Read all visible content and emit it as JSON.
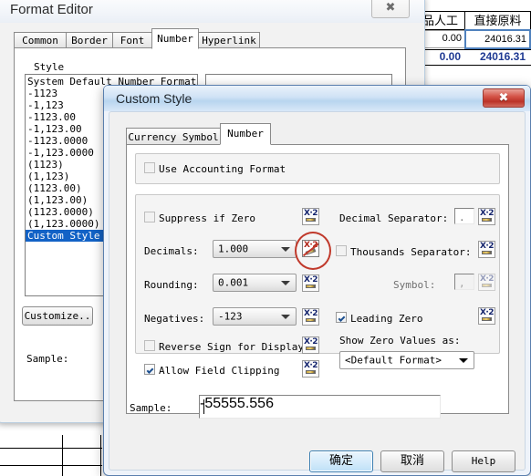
{
  "background_sheet": {
    "headers": [
      {
        "label": "品人工"
      },
      {
        "label": "直接原料"
      }
    ],
    "row_values": [
      "0.00",
      "24016.31"
    ],
    "total_values": [
      "0.00",
      "24016.31"
    ],
    "left_values": [
      "172",
      "70"
    ]
  },
  "format_editor": {
    "title": "Format Editor",
    "close_glyph": "✖",
    "tabs": [
      {
        "label": "Common",
        "selected": false
      },
      {
        "label": "Border",
        "selected": false
      },
      {
        "label": "Font",
        "selected": false
      },
      {
        "label": "Number",
        "selected": true
      },
      {
        "label": "Hyperlink",
        "selected": false
      }
    ],
    "style_group_label": "Style",
    "style_items": [
      {
        "label": "System Default Number Format",
        "selected": false
      },
      {
        "label": "-1123",
        "selected": false
      },
      {
        "label": "-1,123",
        "selected": false
      },
      {
        "label": "-1123.00",
        "selected": false
      },
      {
        "label": "-1,123.00",
        "selected": false
      },
      {
        "label": "-1123.0000",
        "selected": false
      },
      {
        "label": "-1,123.0000",
        "selected": false
      },
      {
        "label": "(1123)",
        "selected": false
      },
      {
        "label": "(1,123)",
        "selected": false
      },
      {
        "label": "(1123.00)",
        "selected": false
      },
      {
        "label": "(1,123.00)",
        "selected": false
      },
      {
        "label": "(1123.0000)",
        "selected": false
      },
      {
        "label": "(1,123.0000)",
        "selected": false
      },
      {
        "label": "Custom Style",
        "selected": true
      }
    ],
    "customize_button": "Customize..",
    "sample_label": "Sample:"
  },
  "custom_style": {
    "title": "Custom Style",
    "close_glyph": "✖",
    "tabs": [
      {
        "label": "Currency Symbol",
        "selected": false
      },
      {
        "label": "Number",
        "selected": true
      }
    ],
    "accounting": {
      "label": "Use Accounting Format",
      "checked": false
    },
    "left_column": {
      "suppress_if_zero": {
        "label": "Suppress if Zero",
        "checked": false,
        "formula_state": "enabled"
      },
      "decimals": {
        "label": "Decimals:",
        "value": "1.000",
        "formula_state": "active"
      },
      "rounding": {
        "label": "Rounding:",
        "value": "0.001",
        "formula_state": "enabled"
      },
      "negatives": {
        "label": "Negatives:",
        "value": "-123",
        "formula_state": "enabled"
      },
      "reverse_sign": {
        "label": "Reverse Sign for Display",
        "checked": false,
        "formula_state": "enabled"
      },
      "allow_field_clipping": {
        "label": "Allow Field Clipping",
        "checked": true,
        "formula_state": "enabled"
      }
    },
    "right_column": {
      "decimal_separator": {
        "label": "Decimal Separator:",
        "value": ".",
        "formula_state": "enabled"
      },
      "thousands_separator": {
        "label": "Thousands Separator:",
        "checked": false,
        "formula_state": "enabled"
      },
      "symbol": {
        "label": "Symbol:",
        "value": ",",
        "formula_state": "disabled"
      },
      "leading_zero": {
        "label": "Leading Zero",
        "checked": true,
        "formula_state": "enabled"
      },
      "show_zero_values_as": {
        "label": "Show Zero Values as:",
        "value": "<Default Format>"
      }
    },
    "sample": {
      "label": "Sample:",
      "value": "-55555.556"
    },
    "buttons": {
      "ok": "确定",
      "cancel": "取消",
      "help": "Help"
    }
  },
  "colors": {
    "selection_blue": "#1262c6",
    "annotation_red": "#c0392b",
    "close_red": "#bb3227",
    "sheet_blue": "#1f3a93"
  }
}
